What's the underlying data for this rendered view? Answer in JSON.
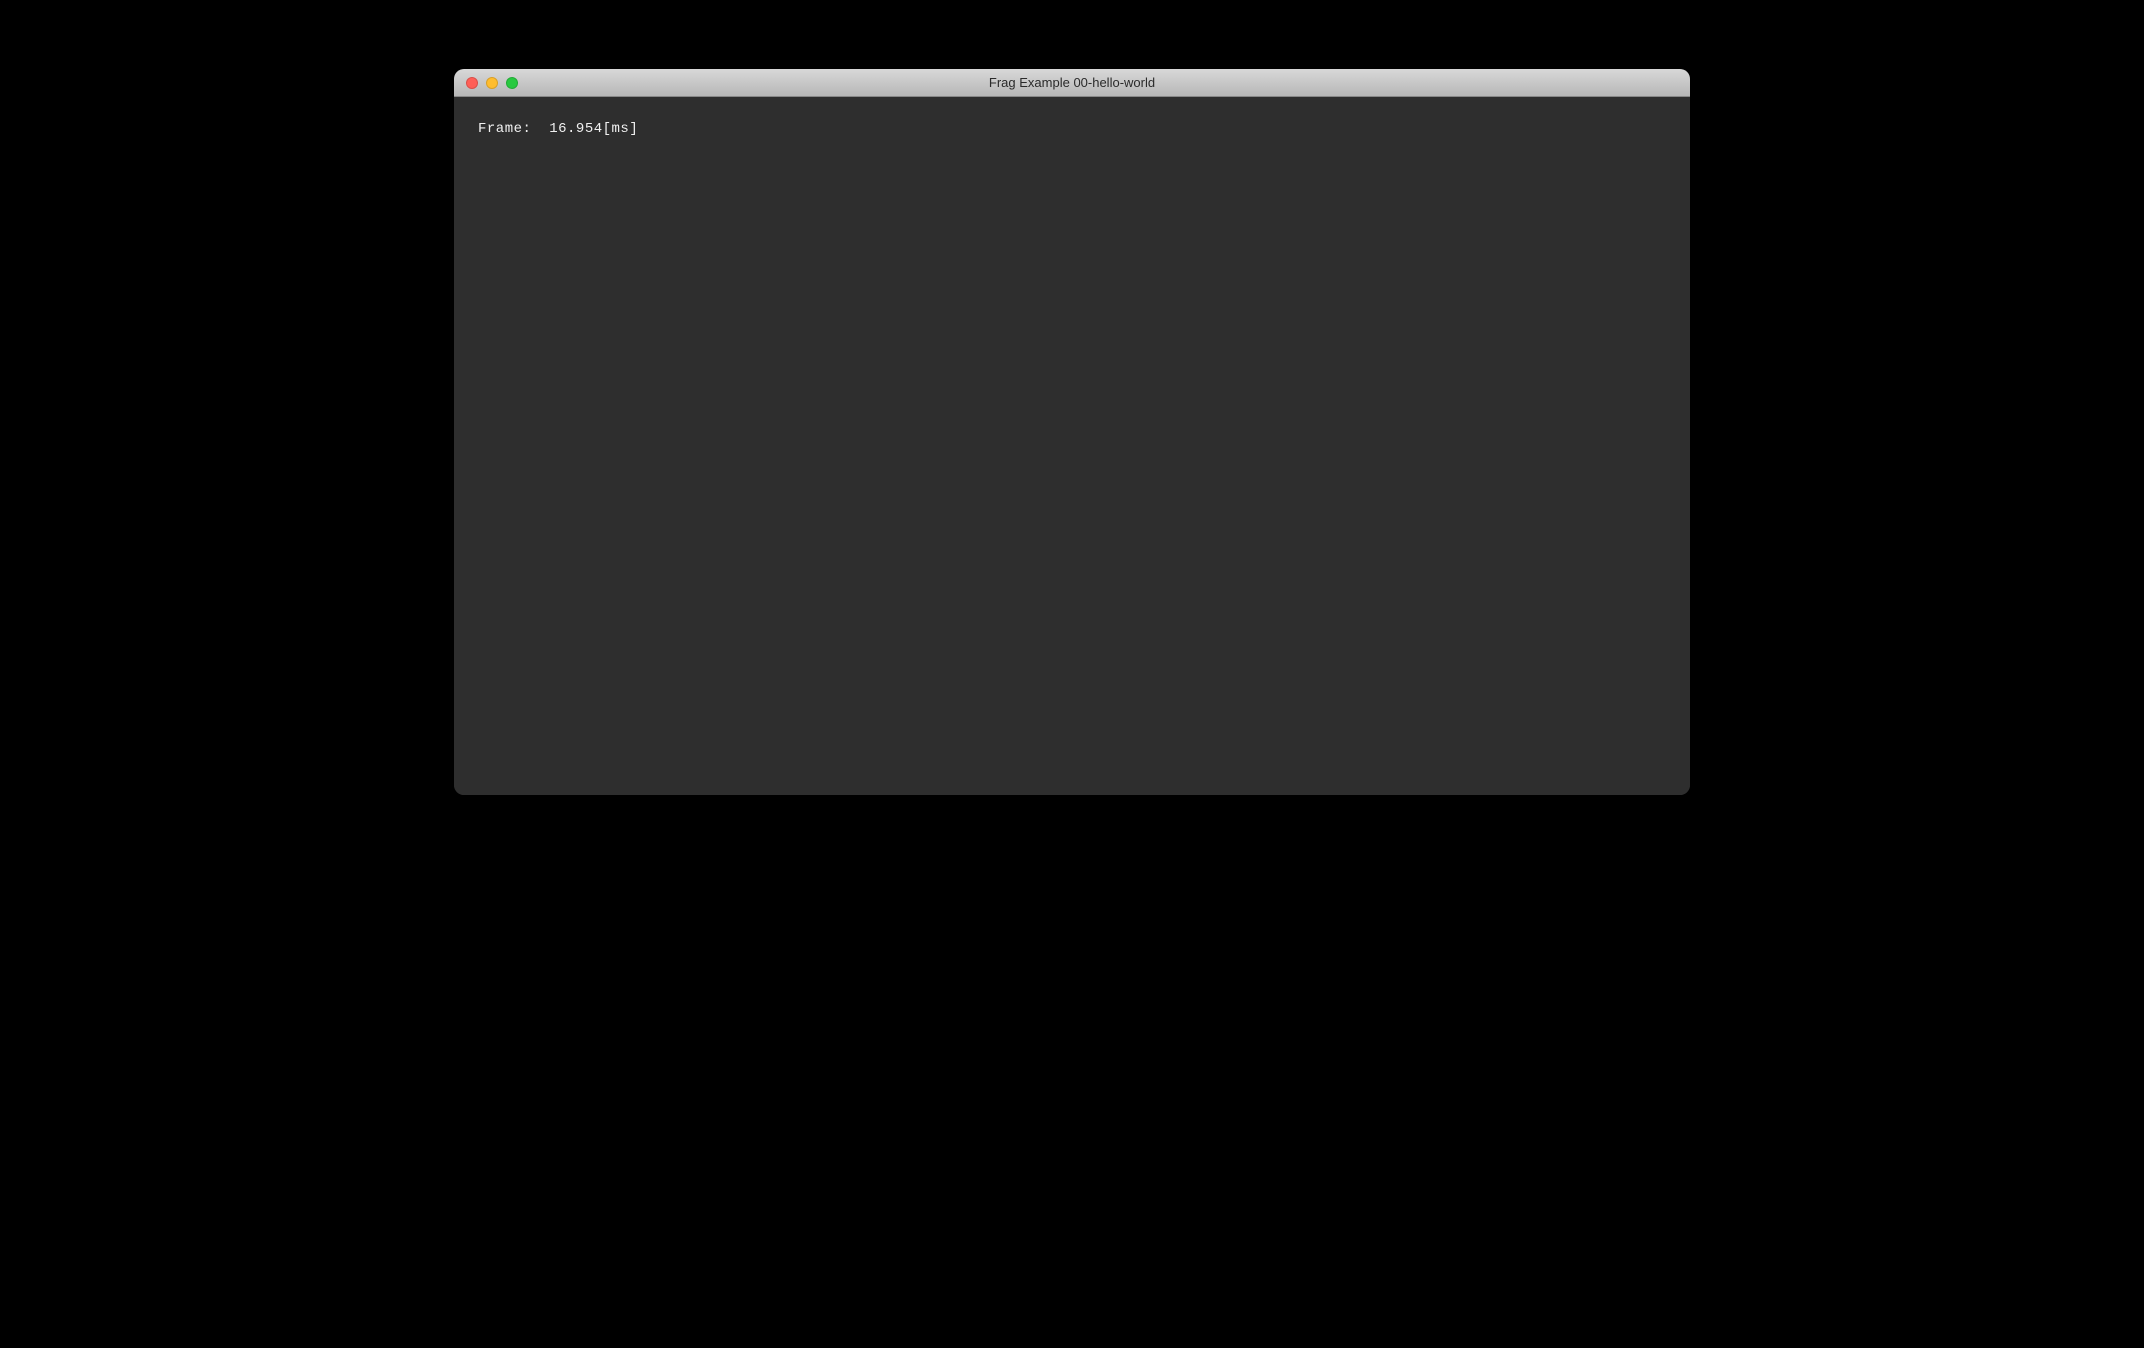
{
  "window": {
    "title": "Frag Example 00-hello-world"
  },
  "stats": {
    "line": "Frame:  16.954[ms]"
  }
}
